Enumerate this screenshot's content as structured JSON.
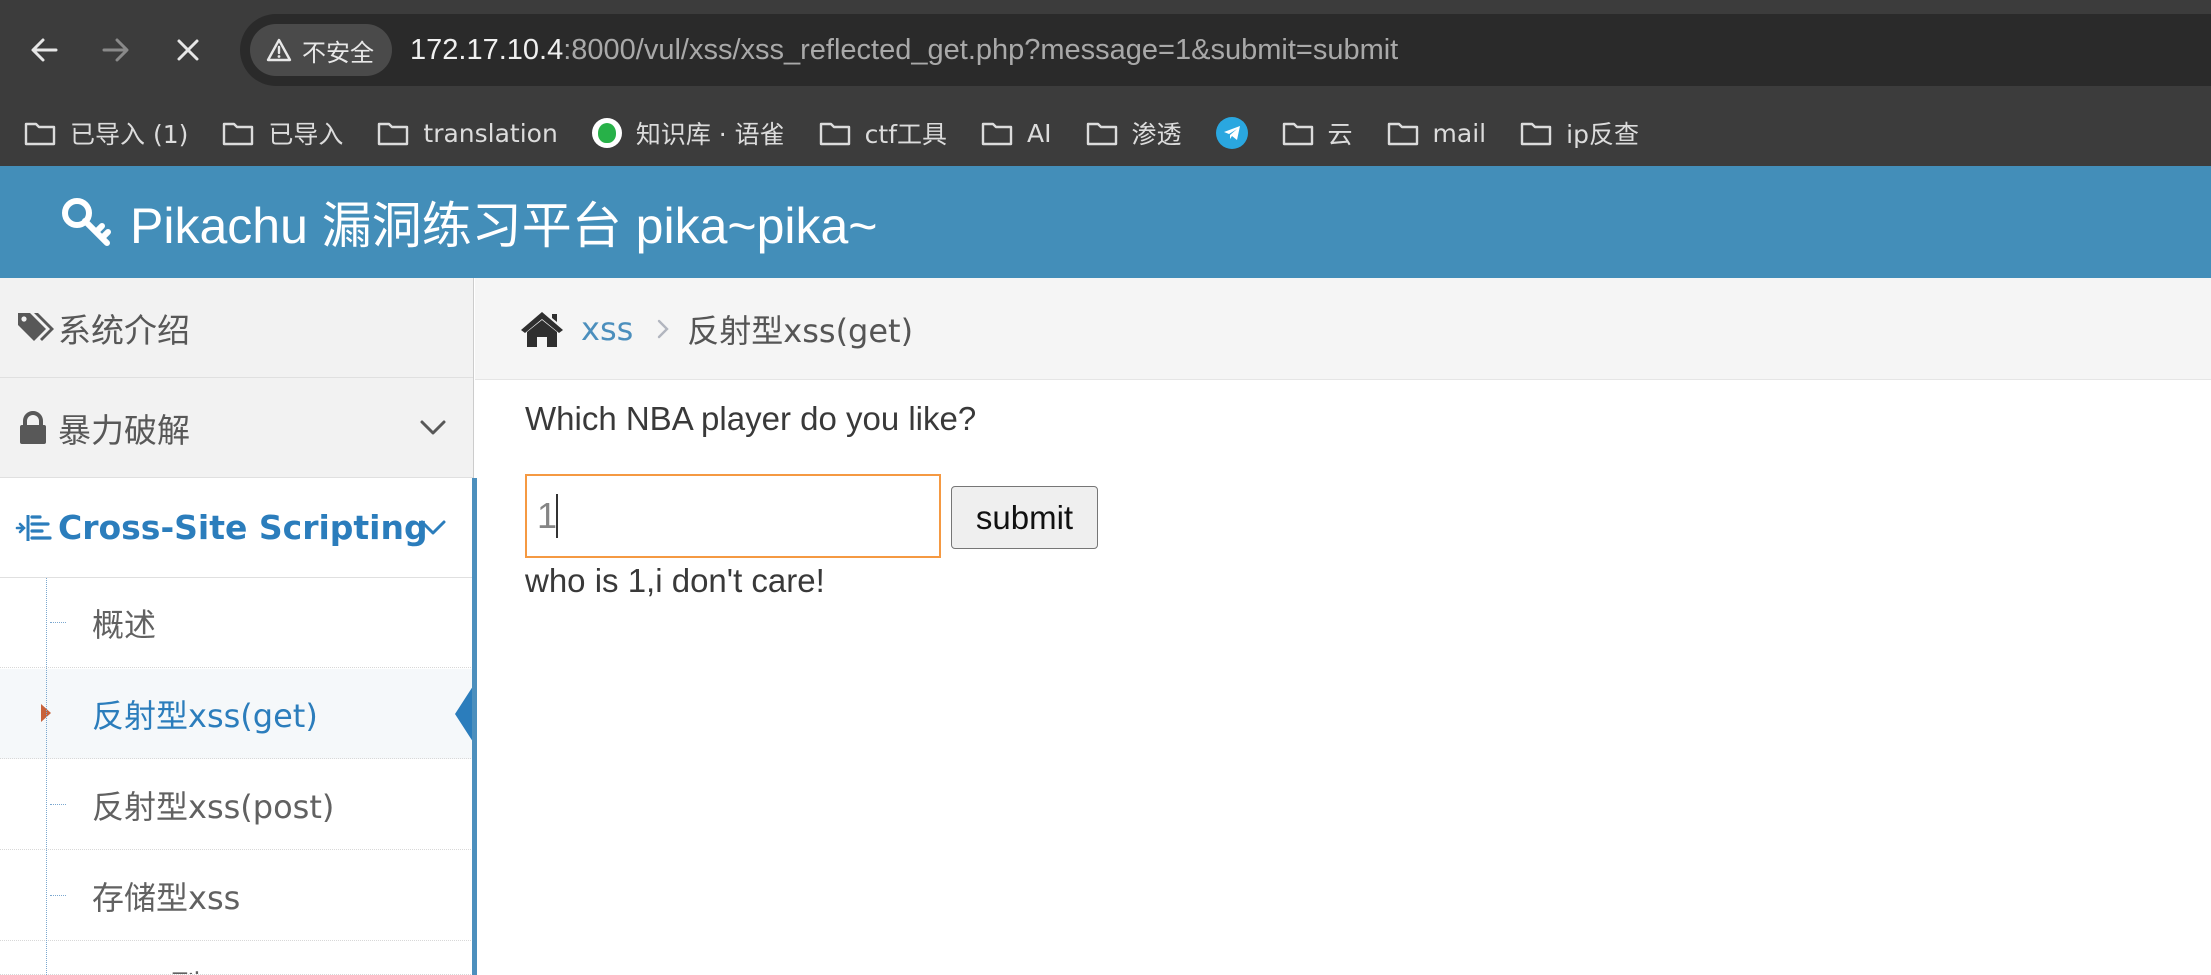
{
  "browser": {
    "security_label": "不安全",
    "url_host": "172.17.10.4",
    "url_rest": ":8000/vul/xss/xss_reflected_get.php?message=1&submit=submit",
    "bookmarks": [
      {
        "label": "已导入 (1)",
        "icon": "folder-icon"
      },
      {
        "label": "已导入",
        "icon": "folder-icon"
      },
      {
        "label": "translation",
        "icon": "folder-icon"
      },
      {
        "label": "知识库 · 语雀",
        "icon": "yuque-icon"
      },
      {
        "label": "ctf工具",
        "icon": "folder-icon"
      },
      {
        "label": "AI",
        "icon": "folder-icon"
      },
      {
        "label": "渗透",
        "icon": "folder-icon"
      },
      {
        "label": "",
        "icon": "telegram-icon"
      },
      {
        "label": "云",
        "icon": "folder-icon"
      },
      {
        "label": "mail",
        "icon": "folder-icon"
      },
      {
        "label": "ip反查",
        "icon": "folder-icon"
      }
    ]
  },
  "header": {
    "title": "Pikachu 漏洞练习平台 pika~pika~",
    "icon": "key-icon"
  },
  "sidebar": {
    "items": [
      {
        "label": "系统介绍",
        "icon": "tags-icon"
      },
      {
        "label": "暴力破解",
        "icon": "lock-icon"
      },
      {
        "label": "Cross-Site Scripting",
        "icon": "list-icon"
      }
    ],
    "subitems": [
      {
        "label": "概述"
      },
      {
        "label": "反射型xss(get)"
      },
      {
        "label": "反射型xss(post)"
      },
      {
        "label": "存储型xss"
      },
      {
        "label": "DOM型"
      }
    ]
  },
  "breadcrumb": {
    "link": "xss",
    "current": "反射型xss(get)"
  },
  "form": {
    "question": "Which NBA player do you like?",
    "input_value": "1",
    "submit_label": "submit",
    "result": "who is 1,i don't care!"
  },
  "colors": {
    "chrome": "#3c3c3c",
    "header": "#438eb9",
    "accent": "#2b7dbc",
    "focus": "#f59942"
  }
}
